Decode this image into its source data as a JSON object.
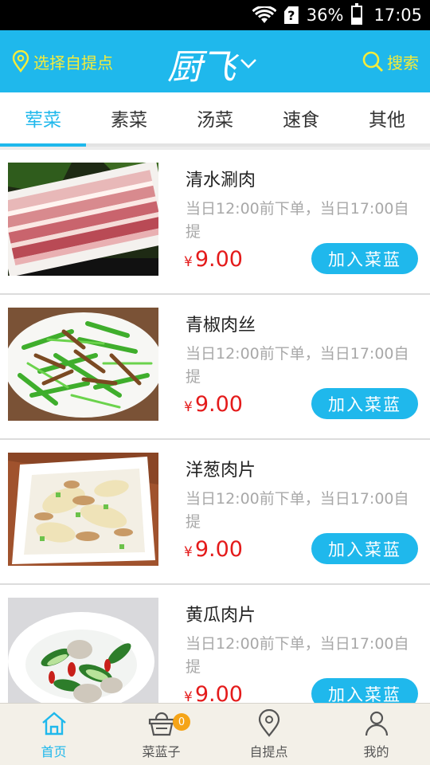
{
  "status_bar": {
    "battery": "36%",
    "time": "17:05"
  },
  "header": {
    "pick_point_label": "选择自提点",
    "logo": "厨飞",
    "search_label": "搜索"
  },
  "tabs": [
    {
      "label": "荤菜",
      "active": true
    },
    {
      "label": "素菜",
      "active": false
    },
    {
      "label": "汤菜",
      "active": false
    },
    {
      "label": "速食",
      "active": false
    },
    {
      "label": "其他",
      "active": false
    }
  ],
  "items": [
    {
      "name": "清水涮肉",
      "desc": "当日12:00前下单，当日17:00自提",
      "currency": "¥",
      "price": "9.00",
      "button": "加入菜蓝",
      "image": "sliced-pork-photo"
    },
    {
      "name": "青椒肉丝",
      "desc": "当日12:00前下单，当日17:00自提",
      "currency": "¥",
      "price": "9.00",
      "button": "加入菜蓝",
      "image": "green-pepper-pork-photo"
    },
    {
      "name": "洋葱肉片",
      "desc": "当日12:00前下单，当日17:00自提",
      "currency": "¥",
      "price": "9.00",
      "button": "加入菜蓝",
      "image": "onion-pork-photo"
    },
    {
      "name": "黄瓜肉片",
      "desc": "当日12:00前下单，当日17:00自提",
      "currency": "¥",
      "price": "9.00",
      "button": "加入菜蓝",
      "image": "cucumber-pork-photo"
    }
  ],
  "bottom_nav": [
    {
      "label": "首页",
      "icon": "home-icon",
      "active": true
    },
    {
      "label": "菜蓝子",
      "icon": "basket-icon",
      "active": false,
      "badge": "0"
    },
    {
      "label": "自提点",
      "icon": "location-pin-icon",
      "active": false
    },
    {
      "label": "我的",
      "icon": "user-icon",
      "active": false
    }
  ],
  "colors": {
    "primary": "#1fb8ec",
    "accent": "#f5ec3a",
    "price": "#e41b1b",
    "badge": "#f5a417"
  }
}
